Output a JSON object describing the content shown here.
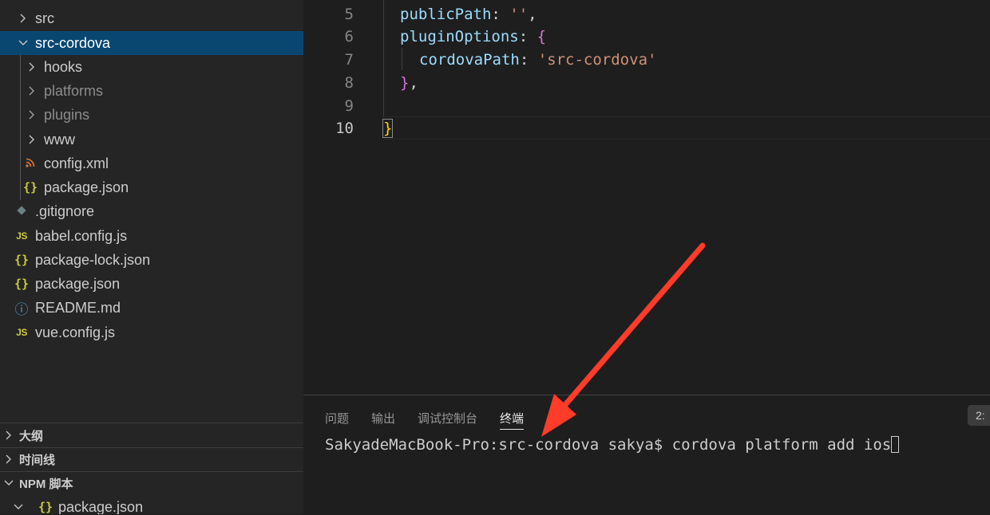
{
  "explorer": {
    "items": [
      {
        "label": "src"
      },
      {
        "label": "src-cordova"
      },
      {
        "label": "hooks"
      },
      {
        "label": "platforms"
      },
      {
        "label": "plugins"
      },
      {
        "label": "www"
      },
      {
        "label": "config.xml"
      },
      {
        "label": "package.json"
      },
      {
        "label": ".gitignore"
      },
      {
        "label": "babel.config.js"
      },
      {
        "label": "package-lock.json"
      },
      {
        "label": "package.json"
      },
      {
        "label": "README.md"
      },
      {
        "label": "vue.config.js"
      }
    ],
    "icons": {
      "js": "JS",
      "json": "{}",
      "info": "ⓘ"
    }
  },
  "sections": {
    "outline": "大纲",
    "timeline": "时间线",
    "npm": "NPM 脚本",
    "npm_item": "package.json"
  },
  "editor": {
    "lines": [
      {
        "num": "5",
        "prop": "publicPath",
        "colon": ": ",
        "str": "''",
        "tail": ","
      },
      {
        "num": "6",
        "prop": "pluginOptions",
        "colon": ": ",
        "brace": "{"
      },
      {
        "num": "7",
        "prop": "cordovaPath",
        "colon": ": ",
        "str": "'src-cordova'"
      },
      {
        "num": "8",
        "brace": "}",
        "tail": ","
      },
      {
        "num": "9"
      },
      {
        "num": "10",
        "gold": "}"
      }
    ]
  },
  "panel": {
    "tabs": [
      "问题",
      "输出",
      "调试控制台",
      "终端"
    ],
    "active_tab": "终端",
    "badge": "2:",
    "terminal_line": "SakyadeMacBook-Pro:src-cordova sakya$ cordova platform add ios"
  },
  "colors": {
    "sidebar_bg": "#252526",
    "selected_bg": "#094771",
    "arrow": "#ff3b2a"
  }
}
